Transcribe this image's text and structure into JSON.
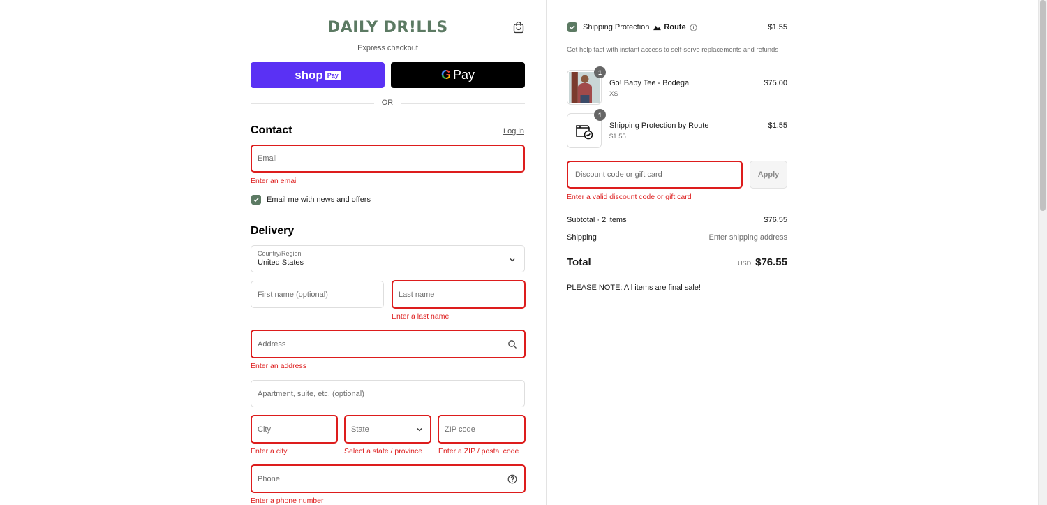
{
  "brand": {
    "logo_text": "DAILY DR!LLS",
    "accent": "#5c7a63",
    "error": "#dd1d1d"
  },
  "express": {
    "title": "Express checkout",
    "shop_pay": {
      "shop": "shop",
      "pay": "Pay",
      "color": "#5a31f4"
    },
    "gpay": {
      "g": "G",
      "pay": "Pay"
    },
    "or_label": "OR"
  },
  "contact": {
    "heading": "Contact",
    "login_link": "Log in",
    "email": {
      "placeholder": "Email",
      "error": "Enter an email"
    },
    "newsletter": {
      "label": "Email me with news and offers",
      "checked": true
    }
  },
  "delivery": {
    "heading": "Delivery",
    "country": {
      "label": "Country/Region",
      "value": "United States"
    },
    "first_name": {
      "placeholder": "First name (optional)"
    },
    "last_name": {
      "placeholder": "Last name",
      "error": "Enter a last name"
    },
    "address": {
      "placeholder": "Address",
      "error": "Enter an address"
    },
    "apartment": {
      "placeholder": "Apartment, suite, etc. (optional)"
    },
    "city": {
      "placeholder": "City",
      "error": "Enter a city"
    },
    "state": {
      "placeholder": "State",
      "error": "Select a state / province"
    },
    "zip": {
      "placeholder": "ZIP code",
      "error": "Enter a ZIP / postal code"
    },
    "phone": {
      "placeholder": "Phone",
      "error": "Enter a phone number"
    }
  },
  "summary": {
    "protection": {
      "label": "Shipping Protection",
      "brand": "Route",
      "price": "$1.55",
      "checked": true,
      "description": "Get help fast with instant access to self-serve replacements and refunds"
    },
    "items": [
      {
        "name": "Go! Baby Tee - Bodega",
        "variant": "XS",
        "price": "$75.00",
        "qty": "1"
      },
      {
        "name": "Shipping Protection by Route",
        "variant": "$1.55",
        "price": "$1.55",
        "qty": "1"
      }
    ],
    "discount": {
      "placeholder": "Discount code or gift card",
      "apply_label": "Apply",
      "error": "Enter a valid discount code or gift card"
    },
    "subtotal": {
      "label": "Subtotal · 2 items",
      "value": "$76.55"
    },
    "shipping": {
      "label": "Shipping",
      "value": "Enter shipping address"
    },
    "total": {
      "label": "Total",
      "currency": "USD",
      "value": "$76.55"
    },
    "note": "PLEASE NOTE: All items are final sale!"
  }
}
